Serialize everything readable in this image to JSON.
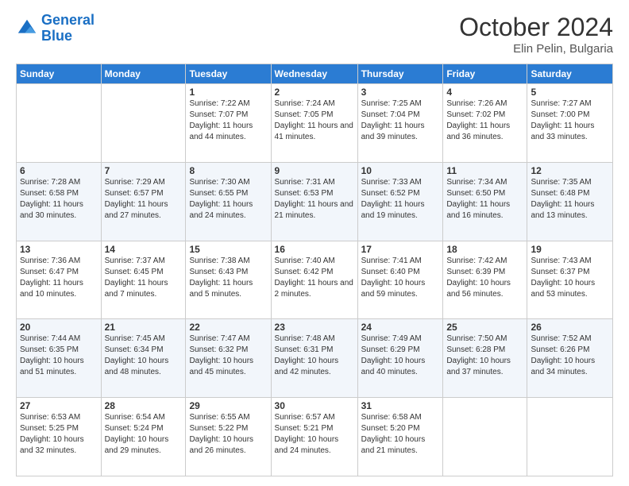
{
  "header": {
    "logo_line1": "General",
    "logo_line2": "Blue",
    "month": "October 2024",
    "location": "Elin Pelin, Bulgaria"
  },
  "days_of_week": [
    "Sunday",
    "Monday",
    "Tuesday",
    "Wednesday",
    "Thursday",
    "Friday",
    "Saturday"
  ],
  "weeks": [
    [
      {
        "day": "",
        "sunrise": "",
        "sunset": "",
        "daylight": ""
      },
      {
        "day": "",
        "sunrise": "",
        "sunset": "",
        "daylight": ""
      },
      {
        "day": "1",
        "sunrise": "Sunrise: 7:22 AM",
        "sunset": "Sunset: 7:07 PM",
        "daylight": "Daylight: 11 hours and 44 minutes."
      },
      {
        "day": "2",
        "sunrise": "Sunrise: 7:24 AM",
        "sunset": "Sunset: 7:05 PM",
        "daylight": "Daylight: 11 hours and 41 minutes."
      },
      {
        "day": "3",
        "sunrise": "Sunrise: 7:25 AM",
        "sunset": "Sunset: 7:04 PM",
        "daylight": "Daylight: 11 hours and 39 minutes."
      },
      {
        "day": "4",
        "sunrise": "Sunrise: 7:26 AM",
        "sunset": "Sunset: 7:02 PM",
        "daylight": "Daylight: 11 hours and 36 minutes."
      },
      {
        "day": "5",
        "sunrise": "Sunrise: 7:27 AM",
        "sunset": "Sunset: 7:00 PM",
        "daylight": "Daylight: 11 hours and 33 minutes."
      }
    ],
    [
      {
        "day": "6",
        "sunrise": "Sunrise: 7:28 AM",
        "sunset": "Sunset: 6:58 PM",
        "daylight": "Daylight: 11 hours and 30 minutes."
      },
      {
        "day": "7",
        "sunrise": "Sunrise: 7:29 AM",
        "sunset": "Sunset: 6:57 PM",
        "daylight": "Daylight: 11 hours and 27 minutes."
      },
      {
        "day": "8",
        "sunrise": "Sunrise: 7:30 AM",
        "sunset": "Sunset: 6:55 PM",
        "daylight": "Daylight: 11 hours and 24 minutes."
      },
      {
        "day": "9",
        "sunrise": "Sunrise: 7:31 AM",
        "sunset": "Sunset: 6:53 PM",
        "daylight": "Daylight: 11 hours and 21 minutes."
      },
      {
        "day": "10",
        "sunrise": "Sunrise: 7:33 AM",
        "sunset": "Sunset: 6:52 PM",
        "daylight": "Daylight: 11 hours and 19 minutes."
      },
      {
        "day": "11",
        "sunrise": "Sunrise: 7:34 AM",
        "sunset": "Sunset: 6:50 PM",
        "daylight": "Daylight: 11 hours and 16 minutes."
      },
      {
        "day": "12",
        "sunrise": "Sunrise: 7:35 AM",
        "sunset": "Sunset: 6:48 PM",
        "daylight": "Daylight: 11 hours and 13 minutes."
      }
    ],
    [
      {
        "day": "13",
        "sunrise": "Sunrise: 7:36 AM",
        "sunset": "Sunset: 6:47 PM",
        "daylight": "Daylight: 11 hours and 10 minutes."
      },
      {
        "day": "14",
        "sunrise": "Sunrise: 7:37 AM",
        "sunset": "Sunset: 6:45 PM",
        "daylight": "Daylight: 11 hours and 7 minutes."
      },
      {
        "day": "15",
        "sunrise": "Sunrise: 7:38 AM",
        "sunset": "Sunset: 6:43 PM",
        "daylight": "Daylight: 11 hours and 5 minutes."
      },
      {
        "day": "16",
        "sunrise": "Sunrise: 7:40 AM",
        "sunset": "Sunset: 6:42 PM",
        "daylight": "Daylight: 11 hours and 2 minutes."
      },
      {
        "day": "17",
        "sunrise": "Sunrise: 7:41 AM",
        "sunset": "Sunset: 6:40 PM",
        "daylight": "Daylight: 10 hours and 59 minutes."
      },
      {
        "day": "18",
        "sunrise": "Sunrise: 7:42 AM",
        "sunset": "Sunset: 6:39 PM",
        "daylight": "Daylight: 10 hours and 56 minutes."
      },
      {
        "day": "19",
        "sunrise": "Sunrise: 7:43 AM",
        "sunset": "Sunset: 6:37 PM",
        "daylight": "Daylight: 10 hours and 53 minutes."
      }
    ],
    [
      {
        "day": "20",
        "sunrise": "Sunrise: 7:44 AM",
        "sunset": "Sunset: 6:35 PM",
        "daylight": "Daylight: 10 hours and 51 minutes."
      },
      {
        "day": "21",
        "sunrise": "Sunrise: 7:45 AM",
        "sunset": "Sunset: 6:34 PM",
        "daylight": "Daylight: 10 hours and 48 minutes."
      },
      {
        "day": "22",
        "sunrise": "Sunrise: 7:47 AM",
        "sunset": "Sunset: 6:32 PM",
        "daylight": "Daylight: 10 hours and 45 minutes."
      },
      {
        "day": "23",
        "sunrise": "Sunrise: 7:48 AM",
        "sunset": "Sunset: 6:31 PM",
        "daylight": "Daylight: 10 hours and 42 minutes."
      },
      {
        "day": "24",
        "sunrise": "Sunrise: 7:49 AM",
        "sunset": "Sunset: 6:29 PM",
        "daylight": "Daylight: 10 hours and 40 minutes."
      },
      {
        "day": "25",
        "sunrise": "Sunrise: 7:50 AM",
        "sunset": "Sunset: 6:28 PM",
        "daylight": "Daylight: 10 hours and 37 minutes."
      },
      {
        "day": "26",
        "sunrise": "Sunrise: 7:52 AM",
        "sunset": "Sunset: 6:26 PM",
        "daylight": "Daylight: 10 hours and 34 minutes."
      }
    ],
    [
      {
        "day": "27",
        "sunrise": "Sunrise: 6:53 AM",
        "sunset": "Sunset: 5:25 PM",
        "daylight": "Daylight: 10 hours and 32 minutes."
      },
      {
        "day": "28",
        "sunrise": "Sunrise: 6:54 AM",
        "sunset": "Sunset: 5:24 PM",
        "daylight": "Daylight: 10 hours and 29 minutes."
      },
      {
        "day": "29",
        "sunrise": "Sunrise: 6:55 AM",
        "sunset": "Sunset: 5:22 PM",
        "daylight": "Daylight: 10 hours and 26 minutes."
      },
      {
        "day": "30",
        "sunrise": "Sunrise: 6:57 AM",
        "sunset": "Sunset: 5:21 PM",
        "daylight": "Daylight: 10 hours and 24 minutes."
      },
      {
        "day": "31",
        "sunrise": "Sunrise: 6:58 AM",
        "sunset": "Sunset: 5:20 PM",
        "daylight": "Daylight: 10 hours and 21 minutes."
      },
      {
        "day": "",
        "sunrise": "",
        "sunset": "",
        "daylight": ""
      },
      {
        "day": "",
        "sunrise": "",
        "sunset": "",
        "daylight": ""
      }
    ]
  ]
}
